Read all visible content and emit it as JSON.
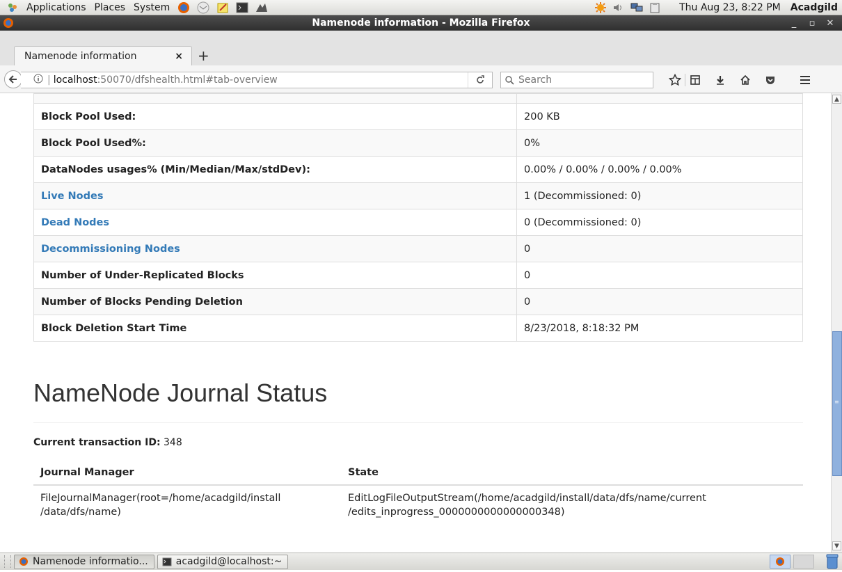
{
  "panel": {
    "menus": [
      "Applications",
      "Places",
      "System"
    ],
    "clock": "Thu Aug 23,  8:22 PM",
    "user": "Acadgild"
  },
  "window": {
    "title": "Namenode information - Mozilla Firefox"
  },
  "tabs": [
    {
      "label": "Namenode information"
    }
  ],
  "navbar": {
    "url_host": "localhost",
    "url_path": ":50070/dfshealth.html#tab-overview",
    "search_placeholder": "Search"
  },
  "summary_table": [
    {
      "key": "Block Pool Used:",
      "value": "200 KB",
      "link": false
    },
    {
      "key": "Block Pool Used%:",
      "value": "0%",
      "link": false
    },
    {
      "key": "DataNodes usages% (Min/Median/Max/stdDev):",
      "value": "0.00% / 0.00% / 0.00% / 0.00%",
      "link": false
    },
    {
      "key": "Live Nodes",
      "value": "1 (Decommissioned: 0)",
      "link": true
    },
    {
      "key": "Dead Nodes",
      "value": "0 (Decommissioned: 0)",
      "link": true
    },
    {
      "key": "Decommissioning Nodes",
      "value": "0",
      "link": true
    },
    {
      "key": "Number of Under-Replicated Blocks",
      "value": "0",
      "link": false
    },
    {
      "key": "Number of Blocks Pending Deletion",
      "value": "0",
      "link": false
    },
    {
      "key": "Block Deletion Start Time",
      "value": "8/23/2018, 8:18:32 PM",
      "link": false
    }
  ],
  "journal": {
    "heading": "NameNode Journal Status",
    "txid_label": "Current transaction ID:",
    "txid_value": "348",
    "columns": [
      "Journal Manager",
      "State"
    ],
    "rows": [
      {
        "manager_line1": "FileJournalManager(root=/home/acadgild/install",
        "manager_line2": "/data/dfs/name)",
        "state_line1": "EditLogFileOutputStream(/home/acadgild/install/data/dfs/name/current",
        "state_line2": "/edits_inprogress_0000000000000000348)"
      }
    ]
  },
  "taskbar": {
    "items": [
      {
        "label": "Namenode informatio...",
        "icon": "firefox-icon"
      },
      {
        "label": "acadgild@localhost:~",
        "icon": "terminal-icon"
      }
    ]
  },
  "colors": {
    "link": "#337ab7",
    "stripe": "#f9f9f9",
    "border": "#dddddd",
    "titlebar": "#3a3a3a"
  }
}
